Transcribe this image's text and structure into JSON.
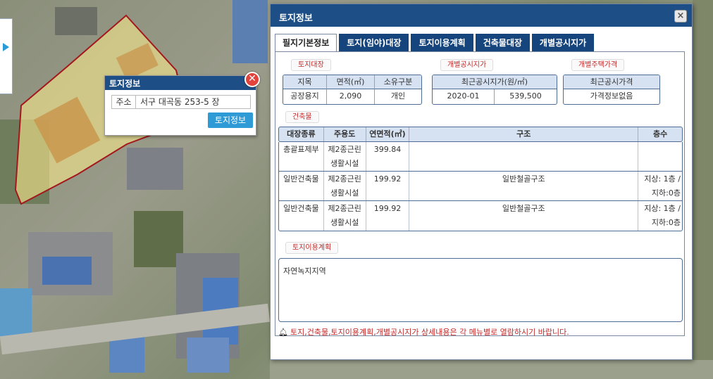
{
  "popup": {
    "title": "토지정보",
    "close_icon": "close-icon",
    "address_label": "주소",
    "address_value": "서구 대곡동 253-5 장",
    "button_label": "토지정보"
  },
  "dialog": {
    "title": "토지정보",
    "close_symbol": "×",
    "tabs": [
      {
        "label": "필지기본정보",
        "active": true
      },
      {
        "label": "토지(임야)대장",
        "active": false
      },
      {
        "label": "토지이용계획",
        "active": false
      },
      {
        "label": "건축물대장",
        "active": false
      },
      {
        "label": "개별공시지가",
        "active": false
      }
    ]
  },
  "land_register": {
    "section_label": "토지대장",
    "headers": [
      "지목",
      "면적(㎡)",
      "소유구분"
    ],
    "values": [
      "공장용지",
      "2,090",
      "개인"
    ]
  },
  "official_price": {
    "section_label": "개별공시지가",
    "header": "최근공시지가(원/㎡)",
    "values": [
      "2020-01",
      "539,500"
    ]
  },
  "housing_price": {
    "section_label": "개별주택가격",
    "header": "최근공시가격",
    "value": "가격정보없음"
  },
  "building": {
    "section_label": "건축물",
    "headers": [
      "대장종류",
      "주용도",
      "연면적(㎡)",
      "구조",
      "층수"
    ],
    "rows": [
      {
        "type": "총괄표제부",
        "use1": "제2종근린",
        "use2": "생활시설",
        "area": "399.84",
        "structure": "",
        "floor1": "",
        "floor2": ""
      },
      {
        "type": "일반건축물",
        "use1": "제2종근린",
        "use2": "생활시설",
        "area": "199.92",
        "structure": "일반철골구조",
        "floor1": "지상: 1층 /",
        "floor2": "지하:0층"
      },
      {
        "type": "일반건축물",
        "use1": "제2종근린",
        "use2": "생활시설",
        "area": "199.92",
        "structure": "일반철골구조",
        "floor1": "지상: 1층 /",
        "floor2": "지하:0층"
      }
    ]
  },
  "land_use": {
    "section_label": "토지이용계획",
    "value": "자연녹지지역"
  },
  "notice": {
    "icon": "bell-icon",
    "text": "토지,건축물,토지이용계획,개별공시지가 상세내용은 각 메뉴별로 열람하시기 바랍니다."
  },
  "colors": {
    "header_blue": "#1e4e86",
    "tab_blue": "#16457e",
    "button_blue": "#2e9ad6",
    "parcel_fill": "#f3e58a",
    "parcel_stroke": "#a3171d",
    "notice_red": "#c62828"
  }
}
